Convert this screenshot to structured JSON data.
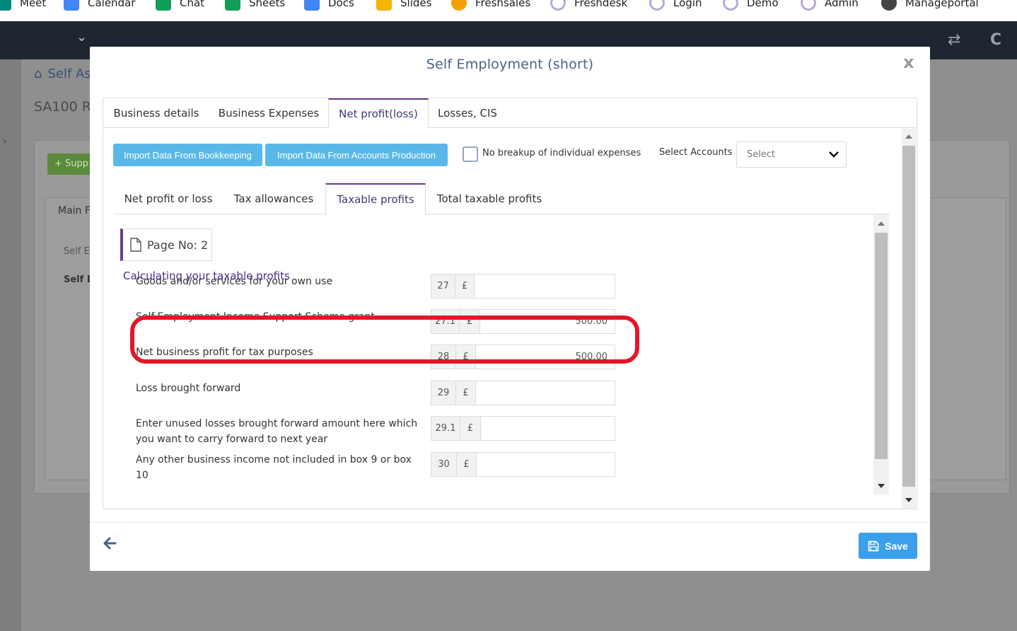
{
  "bookmarks": [
    {
      "label": "Meet",
      "icon": "meet-icon",
      "color": "#00897b"
    },
    {
      "label": "Calendar",
      "icon": "calendar-icon",
      "color": "#4285f4"
    },
    {
      "label": "Chat",
      "icon": "chat-icon",
      "color": "#0f9d58"
    },
    {
      "label": "Sheets",
      "icon": "sheets-icon",
      "color": "#0f9d58"
    },
    {
      "label": "Docs",
      "icon": "docs-icon",
      "color": "#4285f4"
    },
    {
      "label": "Slides",
      "icon": "slides-icon",
      "color": "#f4b400"
    },
    {
      "label": "Freshsales",
      "icon": "freshsales-icon",
      "color": "#f4a000"
    },
    {
      "label": "Freshdesk",
      "icon": "c-icon",
      "color": "#b8a7d8"
    },
    {
      "label": "Login",
      "icon": "c-icon",
      "color": "#b8a7d8"
    },
    {
      "label": "Demo",
      "icon": "c-icon",
      "color": "#b8a7d8"
    },
    {
      "label": "Admin",
      "icon": "c-icon",
      "color": "#b8a7d8"
    },
    {
      "label": "Manageportal",
      "icon": "globe-icon",
      "color": "#444444"
    }
  ],
  "background": {
    "breadcrumb": "Self As",
    "page_title": "SA100 Re",
    "green_button": "Supp",
    "main_tab": "Main F",
    "row1": "Self E",
    "row2": "Self E"
  },
  "modal": {
    "title": "Self Employment (short)",
    "close": "x",
    "outer_tabs": [
      "Business details",
      "Business Expenses",
      "Net profit(loss)",
      "Losses, CIS"
    ],
    "import_bookkeeping": "Import Data From Bookkeeping",
    "import_accounts": "Import Data From Accounts Production",
    "no_breakup_label": "No breakup of individual expenses",
    "select_accounts_label": "Select Accounts",
    "select_value": "Select",
    "inner_tabs": [
      "Net profit or loss",
      "Tax allowances",
      "Taxable profits",
      "Total taxable profits"
    ],
    "page_no": "Page No: 2",
    "section_title": "Calculating your taxable profits",
    "rows": [
      {
        "label": "Goods and/or services for your own use",
        "box": "27",
        "currency": "£",
        "value": ""
      },
      {
        "label": "Self-Employment Income Support Scheme grant",
        "box": "27.1",
        "currency": "£",
        "value": "500.00"
      },
      {
        "label": "Net business profit for tax purposes",
        "box": "28",
        "currency": "£",
        "value": "500.00"
      },
      {
        "label": "Loss brought forward",
        "box": "29",
        "currency": "£",
        "value": ""
      },
      {
        "label": "Enter unused losses brought forward amount here which you want to carry forward to next year",
        "box": "29.1",
        "currency": "£",
        "value": ""
      },
      {
        "label": "Any other business income not included in box 9 or box 10",
        "box": "30",
        "currency": "£",
        "value": ""
      }
    ],
    "save_label": "Save"
  },
  "colors": {
    "accent_purple": "#6a3d8f",
    "import_button": "#5ab8e8",
    "save_button": "#3aa0ec",
    "highlight": "#e0172a"
  }
}
